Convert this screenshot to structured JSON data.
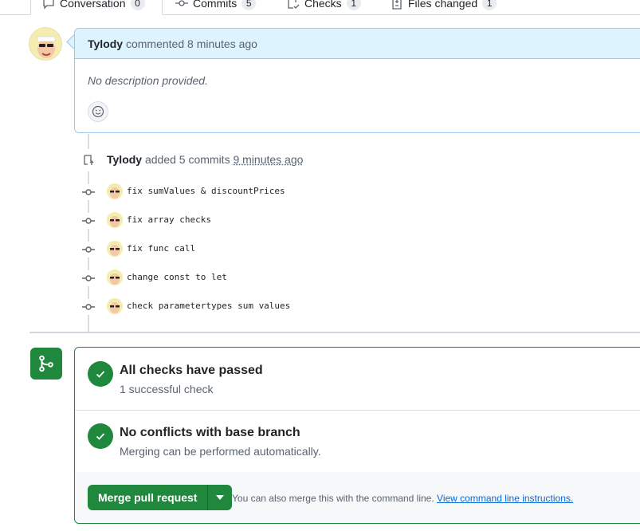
{
  "tabs": [
    {
      "label": "Conversation",
      "count": "0"
    },
    {
      "label": "Commits",
      "count": "5"
    },
    {
      "label": "Checks",
      "count": "1"
    },
    {
      "label": "Files changed",
      "count": "1"
    }
  ],
  "comment": {
    "author": "Tylody",
    "action": "commented",
    "time": "8 minutes ago",
    "body": "No description provided."
  },
  "push_event": {
    "author": "Tylody",
    "action": "added 5 commits",
    "time": "9 minutes ago"
  },
  "commits": [
    {
      "message": "fix sumValues & discountPrices"
    },
    {
      "message": "fix array checks"
    },
    {
      "message": "fix func call"
    },
    {
      "message": "change const to let"
    },
    {
      "message": "check parametertypes sum values"
    }
  ],
  "merge": {
    "checks_title": "All checks have passed",
    "checks_sub": "1 successful check",
    "conflicts_title": "No conflicts with base branch",
    "conflicts_sub": "Merging can be performed automatically.",
    "button_label": "Merge pull request",
    "hint_text": "You can also merge this with the command line.",
    "hint_link": "View command line instructions."
  },
  "colors": {
    "success": "#1f883d",
    "link": "#0969da",
    "comment_header": "#ddf4ff"
  }
}
